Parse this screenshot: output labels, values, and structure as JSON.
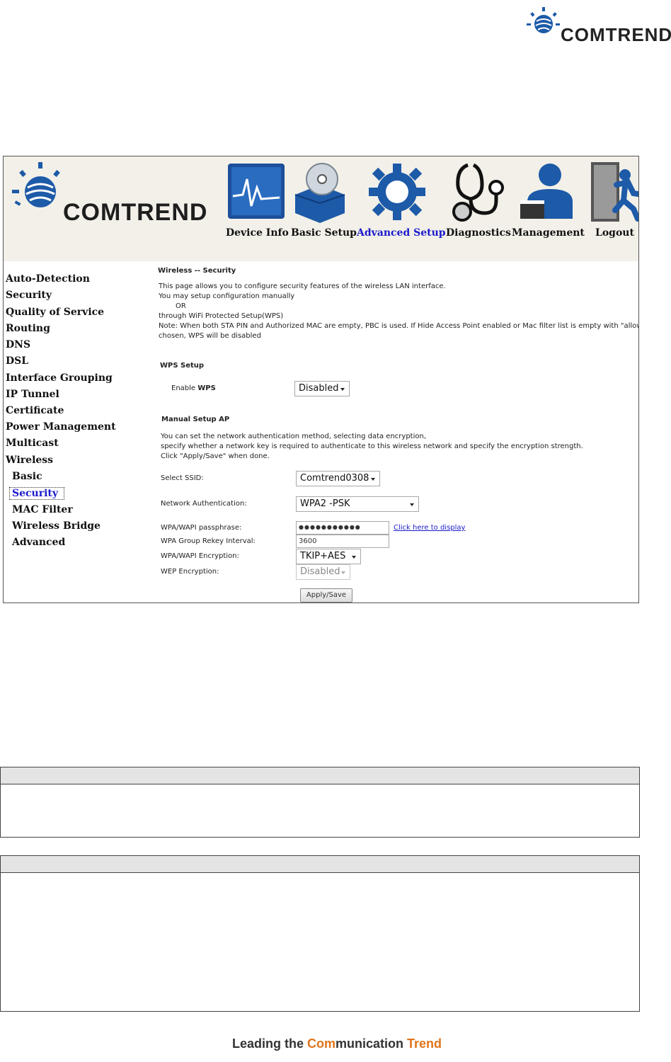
{
  "brand": {
    "logo_text": "COMTREND"
  },
  "nav": [
    {
      "label": "Device Info",
      "icon": "device-info-icon",
      "active": false
    },
    {
      "label": "Basic Setup",
      "icon": "basic-setup-icon",
      "active": false
    },
    {
      "label": "Advanced Setup",
      "icon": "advanced-setup-icon",
      "active": true
    },
    {
      "label": "Diagnostics",
      "icon": "diagnostics-icon",
      "active": false
    },
    {
      "label": "Management",
      "icon": "management-icon",
      "active": false
    },
    {
      "label": "Logout",
      "icon": "logout-icon",
      "active": false
    }
  ],
  "sidebar": {
    "items": [
      "Auto-Detection",
      "Security",
      "Quality of Service",
      "Routing",
      "DNS",
      "DSL",
      "Interface Grouping",
      "IP Tunnel",
      "Certificate",
      "Power Management",
      "Multicast",
      "Wireless"
    ],
    "sub_items": [
      "Basic",
      "Security",
      "MAC Filter",
      "Wireless Bridge",
      "Advanced"
    ]
  },
  "content": {
    "title": "Wireless -- Security",
    "intro_1": "This page allows you to configure security features of the wireless LAN interface.",
    "intro_2": "You may setup configuration manually",
    "intro_or": "OR",
    "intro_3": "through WiFi Protected Setup(WPS)",
    "intro_note_1": "Note: When both STA PIN and Authorized MAC are empty, PBC is used. If Hide Access Point enabled or Mac filter list is empty with \"allow\"",
    "intro_note_2": "chosen, WPS will be disabled",
    "wps_heading": "WPS Setup",
    "enable_wps_label": "Enable",
    "enable_wps_bold": "WPS",
    "enable_wps_value": "Disabled",
    "manual_heading": "Manual Setup AP",
    "manual_1": "You can set the network authentication method, selecting data encryption,",
    "manual_2": "specify whether a network key is required to authenticate to this wireless network and specify the encryption strength.",
    "manual_3": "Click \"Apply/Save\" when done.",
    "ssid_label": "Select SSID:",
    "ssid_value": "Comtrend0308",
    "auth_label": "Network Authentication:",
    "auth_value": "WPA2 -PSK",
    "pass_label": "WPA/WAPI passphrase:",
    "pass_value": "●●●●●●●●●●●",
    "pass_link": "Click here to display",
    "rekey_label": "WPA Group Rekey Interval:",
    "rekey_value": "3600",
    "enc_label": "WPA/WAPI Encryption:",
    "enc_value": "TKIP+AES",
    "wep_label": "WEP Encryption:",
    "wep_value": "Disabled",
    "apply_button": "Apply/Save"
  },
  "footer": {
    "pre": "Leading the ",
    "highlight": "Com",
    "mid": "munication ",
    "highlight2": "Trend"
  },
  "colors": {
    "active_link": "#1a1acc",
    "header_bg": "#f2f0e8",
    "footer_accent": "#e0741b"
  }
}
